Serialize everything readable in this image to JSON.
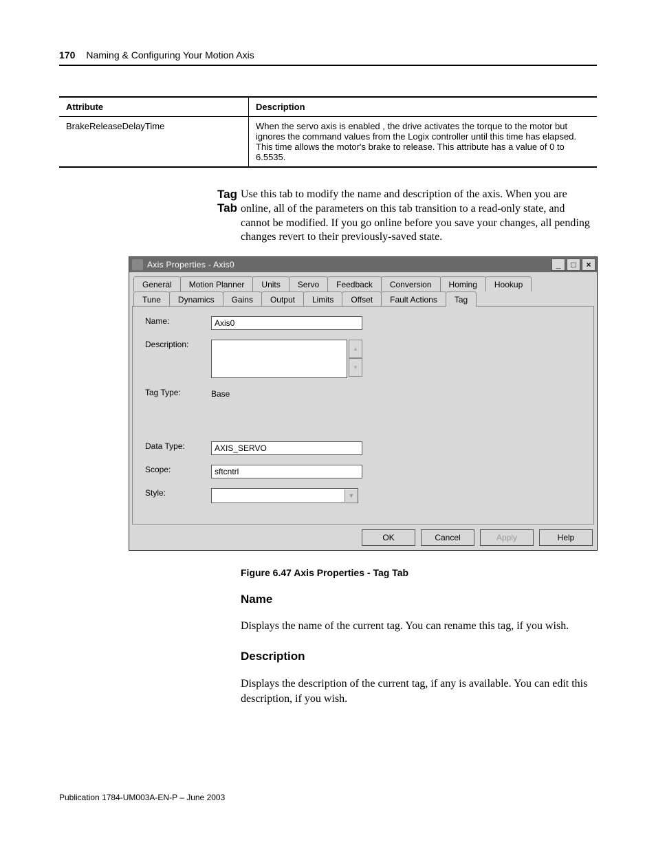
{
  "header": {
    "page": "170",
    "chapter": "Naming & Configuring Your Motion Axis"
  },
  "attr_table": {
    "col_attr": "Attribute",
    "col_desc": "Description",
    "rows": [
      {
        "attr": "BrakeReleaseDelayTime",
        "desc": "When the servo axis is enabled , the drive activates the torque to the motor but ignores the command values from the Logix controller until this time has elapsed. This time allows the motor's brake to release. This attribute has a value of 0 to 6.5535."
      }
    ]
  },
  "tag_tab": {
    "side_title": "Tag Tab",
    "intro": "Use this tab to modify the name and description of the axis. When you are online, all of the parameters on this tab transition to a read-only state, and cannot be modified. If you go online before you save your changes, all pending changes revert to their previously-saved state."
  },
  "window": {
    "title": "Axis Properties - Axis0",
    "tabs_row1": [
      "General",
      "Motion Planner",
      "Units",
      "Servo",
      "Feedback",
      "Conversion",
      "Homing",
      "Hookup"
    ],
    "tabs_row2": [
      "Tune",
      "Dynamics",
      "Gains",
      "Output",
      "Limits",
      "Offset",
      "Fault Actions",
      "Tag"
    ],
    "labels": {
      "name": "Name:",
      "description": "Description:",
      "tag_type": "Tag Type:",
      "data_type": "Data Type:",
      "scope": "Scope:",
      "style": "Style:"
    },
    "values": {
      "name": "Axis0",
      "description": "",
      "tag_type": "Base",
      "data_type": "AXIS_SERVO",
      "scope": "sftcntrl",
      "style": ""
    },
    "buttons": {
      "ok": "OK",
      "cancel": "Cancel",
      "apply": "Apply",
      "help": "Help"
    }
  },
  "figure_caption": "Figure 6.47 Axis Properties - Tag Tab",
  "sections": {
    "name_h": "Name",
    "name_p": "Displays the name of the current tag. You can rename this tag, if you wish.",
    "desc_h": "Description",
    "desc_p": "Displays the description of the current tag, if any is available. You can edit this description, if you wish."
  },
  "footer": "Publication 1784-UM003A-EN-P – June 2003"
}
